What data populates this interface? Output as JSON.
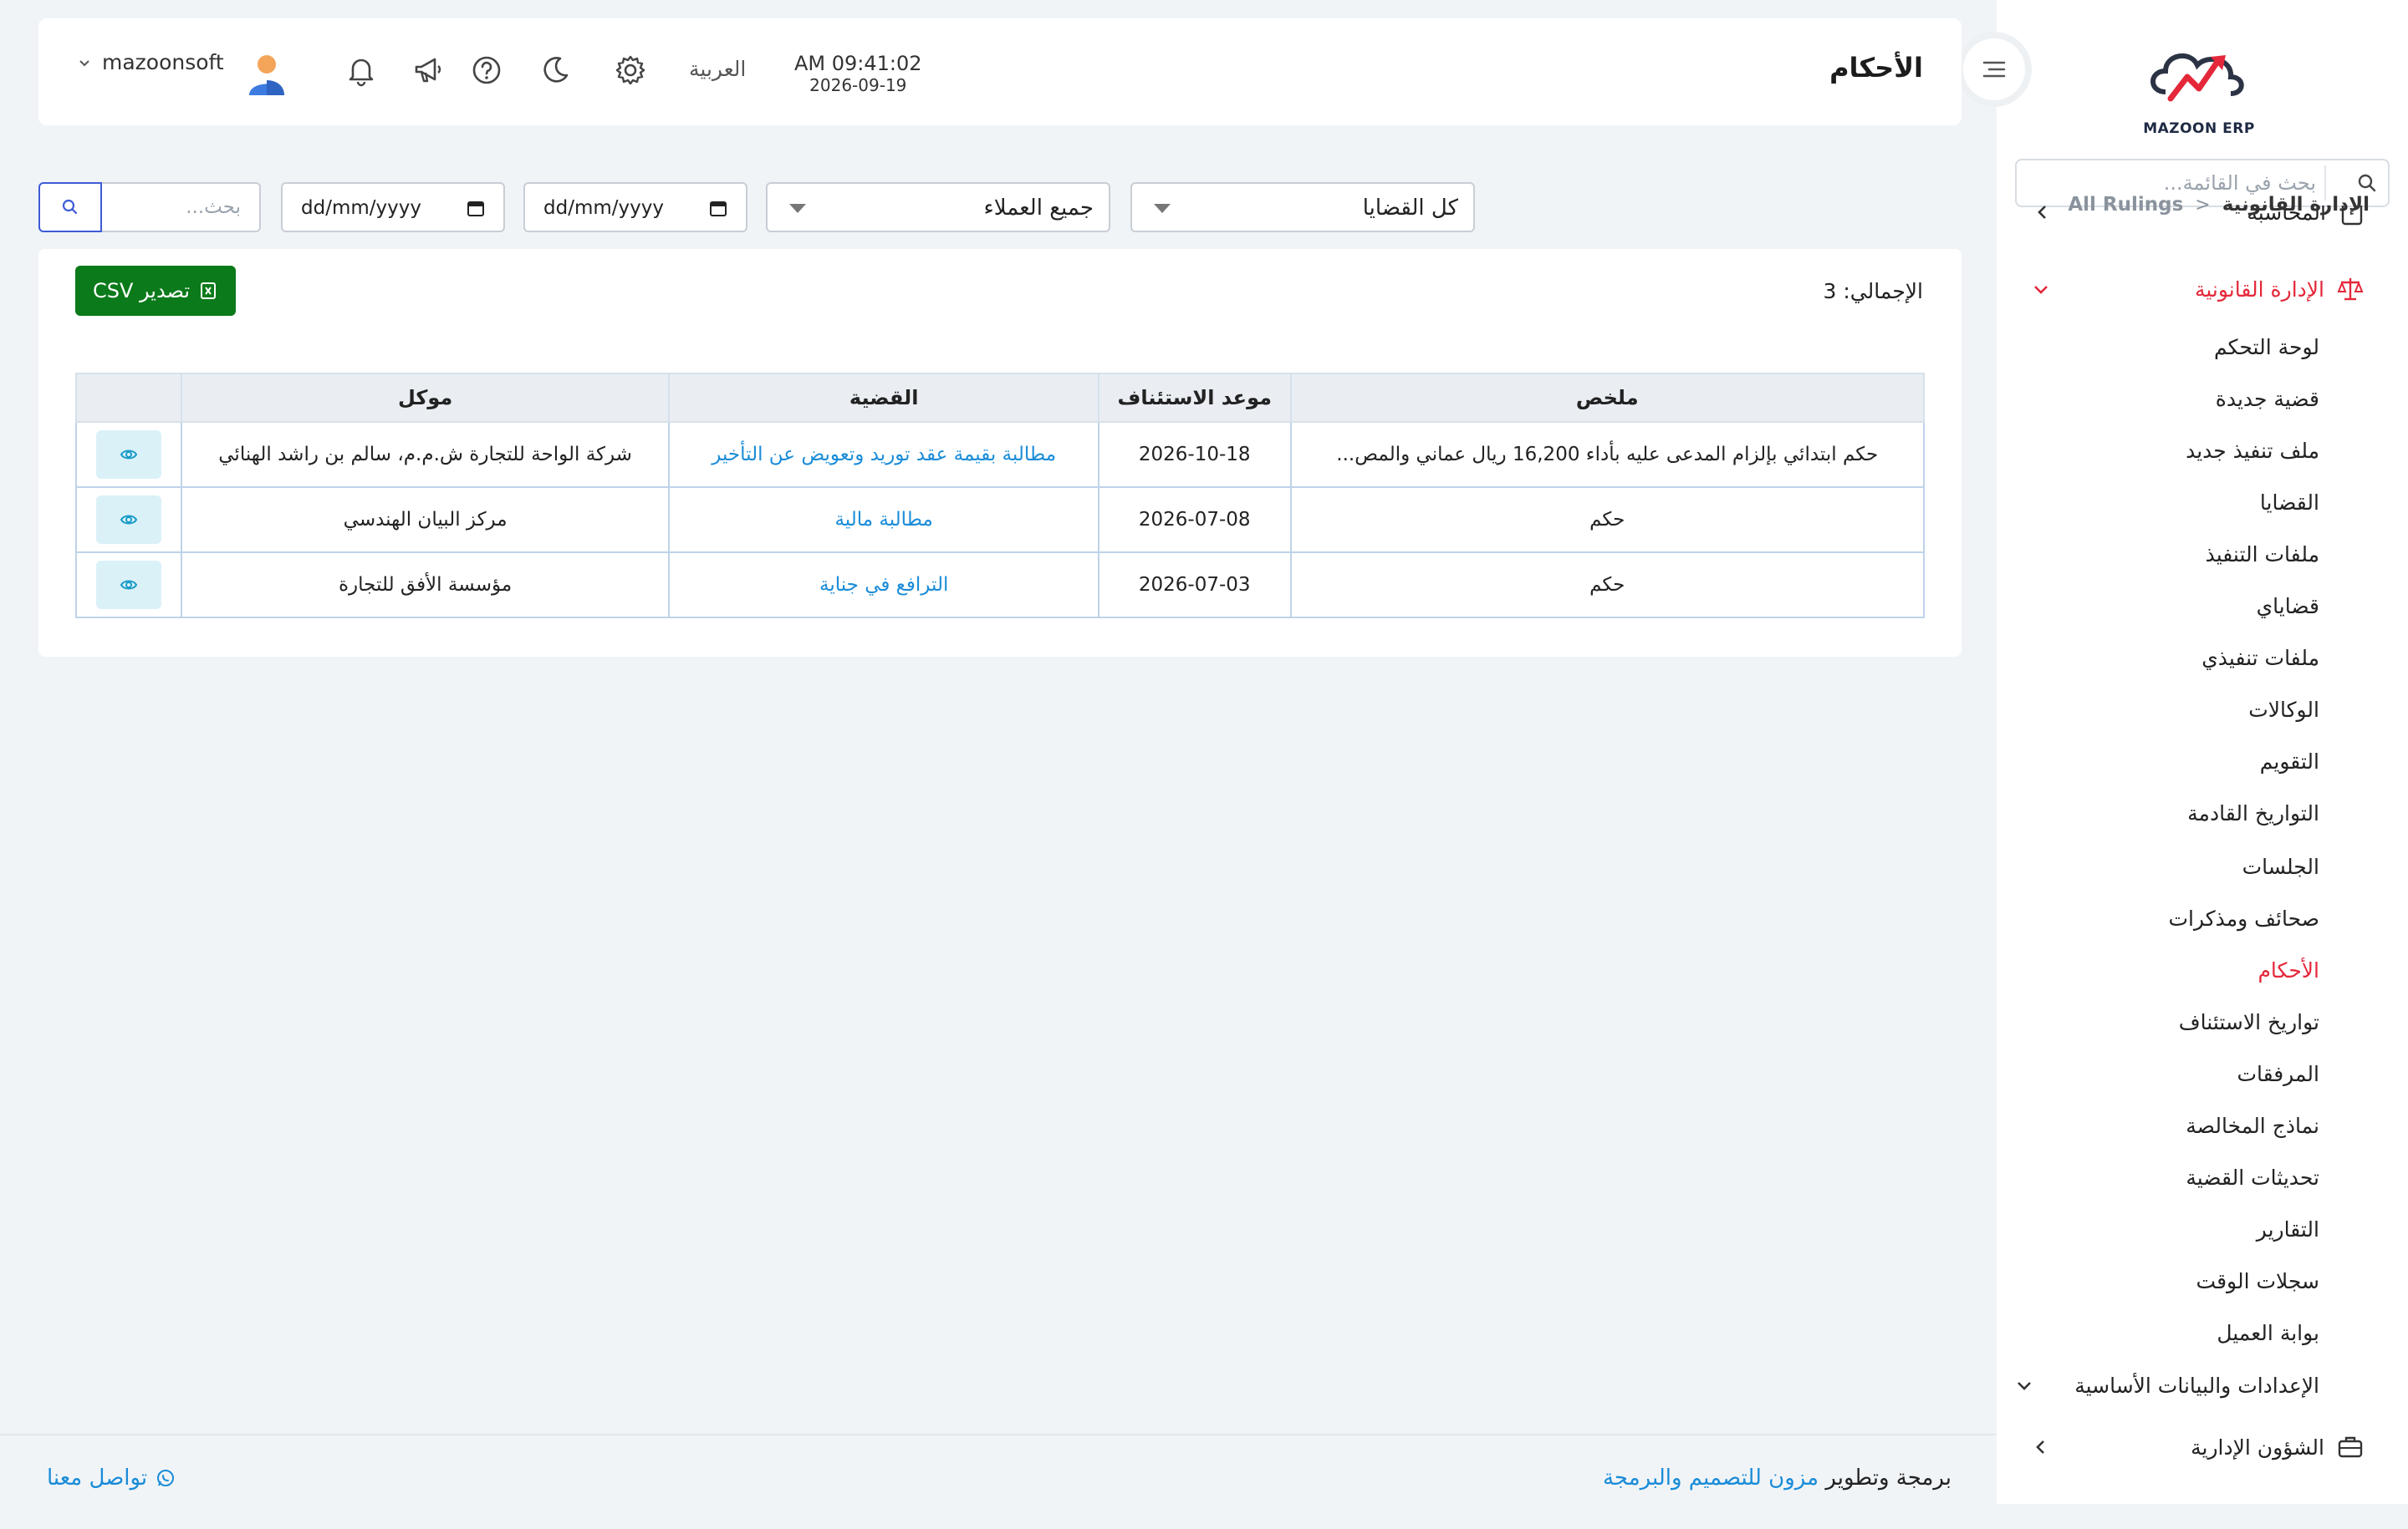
{
  "sidebar": {
    "logo_text": "MAZOON ERP",
    "logo_small": "مزون ERP",
    "search_placeholder": "بحث في القائمة...",
    "partial_item": "المحاسبة",
    "group_legal": "الإدارة القانونية",
    "legal_items": [
      "لوحة التحكم",
      "قضية جديدة",
      "ملف تنفيذ جديد",
      "القضايا",
      "ملفات التنفيذ",
      "قضاياي",
      "ملفات تنفيذي",
      "الوكالات",
      "التقويم",
      "التواريخ القادمة",
      "الجلسات",
      "صحائف ومذكرات",
      "الأحكام",
      "تواريخ الاستئناف",
      "المرفقات",
      "نماذج المخالصة",
      "تحديثات القضية",
      "التقارير",
      "سجلات الوقت",
      "بوابة العميل"
    ],
    "active_item": "الأحكام",
    "group_settings": "الإعدادات والبيانات الأساسية",
    "group_admin": "الشؤون الإدارية"
  },
  "header": {
    "title": "الأحكام",
    "time": "AM 09:41:02",
    "date": "2026-09-19",
    "language": "العربية",
    "username": "mazoonsoft"
  },
  "breadcrumb": {
    "root": "الإدارة القانونية",
    "separator": "<",
    "current": "All Rulings"
  },
  "filters": {
    "cases": "كل القضايا",
    "clients": "جميع العملاء",
    "date_from": "dd/mm/yyyy",
    "date_to": "dd/mm/yyyy",
    "search_placeholder": "بحث..."
  },
  "summary": {
    "total_label": "الإجمالي: 3",
    "export_label": "تصدير CSV"
  },
  "table": {
    "headers": {
      "summary": "ملخص",
      "appeal_date": "موعد الاستئناف",
      "case": "القضية",
      "client": "موكل"
    },
    "rows": [
      {
        "summary": "حكم ابتدائي بإلزام المدعى عليه بأداء 16,200 ريال عماني والمص...",
        "appeal_date": "2026-10-18",
        "case": "مطالبة بقيمة عقد توريد وتعويض عن التأخير",
        "client": "شركة الواحة للتجارة ش.م.م، سالم بن راشد الهنائي"
      },
      {
        "summary": "حكم",
        "appeal_date": "2026-07-08",
        "case": "مطالبة مالية",
        "client": "مركز البيان الهندسي"
      },
      {
        "summary": "حكم",
        "appeal_date": "2026-07-03",
        "case": "الترافع في جناية",
        "client": "مؤسسة الأفق للتجارة"
      }
    ]
  },
  "footer": {
    "prefix": "برمجة وتطوير",
    "brand": "مزون للتصميم والبرمجة",
    "contact": "تواصل معنا"
  },
  "colors": {
    "accent_red": "#e4283a",
    "link_blue": "#1a8cd8",
    "export_green": "#0b7a1a"
  }
}
